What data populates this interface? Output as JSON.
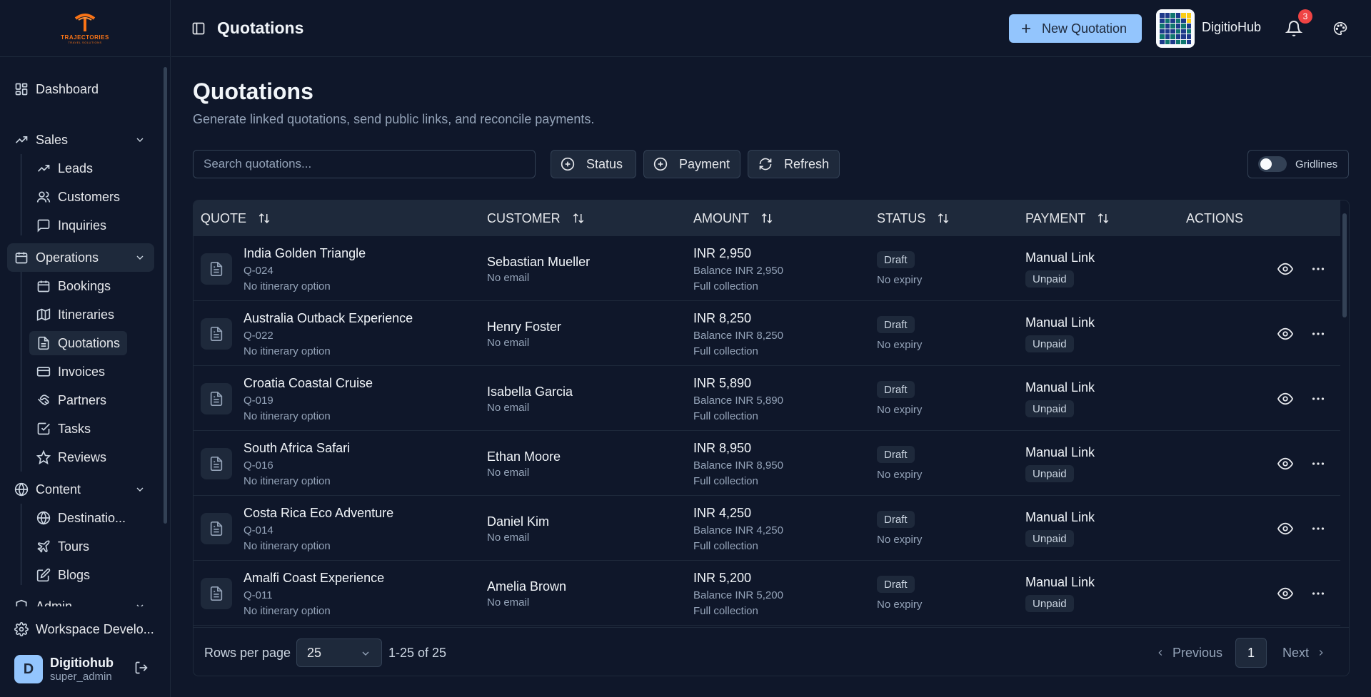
{
  "brand": {
    "logo_text": "TRAJECTORIES",
    "logo_sub": "TRAVEL SOLUTIONS"
  },
  "sidebar": {
    "dashboard": "Dashboard",
    "sales": {
      "label": "Sales",
      "items": [
        "Leads",
        "Customers",
        "Inquiries"
      ]
    },
    "operations": {
      "label": "Operations",
      "items": [
        "Bookings",
        "Itineraries",
        "Quotations",
        "Invoices",
        "Partners",
        "Tasks",
        "Reviews"
      ]
    },
    "content": {
      "label": "Content",
      "items": [
        "Destinatio...",
        "Tours",
        "Blogs"
      ]
    },
    "admin": "Admin",
    "workspace": "Workspace Develo...",
    "user": {
      "initial": "D",
      "name": "Digitiohub",
      "role": "super_admin"
    }
  },
  "header": {
    "title": "Quotations",
    "new_button": "New Quotation",
    "org_name": "DigitioHub",
    "notifications": "3"
  },
  "main": {
    "title": "Quotations",
    "subtitle": "Generate linked quotations, send public links, and reconcile payments.",
    "search_placeholder": "Search quotations...",
    "filters": {
      "status": "Status",
      "payment": "Payment",
      "refresh": "Refresh"
    },
    "gridlines": "Gridlines"
  },
  "table": {
    "columns": {
      "quote": "QUOTE",
      "customer": "CUSTOMER",
      "amount": "AMOUNT",
      "status": "STATUS",
      "payment": "PAYMENT",
      "actions": "ACTIONS"
    },
    "rows": [
      {
        "title": "India Golden Triangle",
        "code": "Q-024",
        "option": "No itinerary option",
        "customer": "Sebastian Mueller",
        "email": "No email",
        "amount": "INR 2,950",
        "balance": "Balance INR 2,950",
        "collection": "Full collection",
        "status": "Draft",
        "expiry": "No expiry",
        "method": "Manual Link",
        "payment": "Unpaid"
      },
      {
        "title": "Australia Outback Experience",
        "code": "Q-022",
        "option": "No itinerary option",
        "customer": "Henry Foster",
        "email": "No email",
        "amount": "INR 8,250",
        "balance": "Balance INR 8,250",
        "collection": "Full collection",
        "status": "Draft",
        "expiry": "No expiry",
        "method": "Manual Link",
        "payment": "Unpaid"
      },
      {
        "title": "Croatia Coastal Cruise",
        "code": "Q-019",
        "option": "No itinerary option",
        "customer": "Isabella Garcia",
        "email": "No email",
        "amount": "INR 5,890",
        "balance": "Balance INR 5,890",
        "collection": "Full collection",
        "status": "Draft",
        "expiry": "No expiry",
        "method": "Manual Link",
        "payment": "Unpaid"
      },
      {
        "title": "South Africa Safari",
        "code": "Q-016",
        "option": "No itinerary option",
        "customer": "Ethan Moore",
        "email": "No email",
        "amount": "INR 8,950",
        "balance": "Balance INR 8,950",
        "collection": "Full collection",
        "status": "Draft",
        "expiry": "No expiry",
        "method": "Manual Link",
        "payment": "Unpaid"
      },
      {
        "title": "Costa Rica Eco Adventure",
        "code": "Q-014",
        "option": "No itinerary option",
        "customer": "Daniel Kim",
        "email": "No email",
        "amount": "INR 4,250",
        "balance": "Balance INR 4,250",
        "collection": "Full collection",
        "status": "Draft",
        "expiry": "No expiry",
        "method": "Manual Link",
        "payment": "Unpaid"
      },
      {
        "title": "Amalfi Coast Experience",
        "code": "Q-011",
        "option": "No itinerary option",
        "customer": "Amelia Brown",
        "email": "No email",
        "amount": "INR 5,200",
        "balance": "Balance INR 5,200",
        "collection": "Full collection",
        "status": "Draft",
        "expiry": "No expiry",
        "method": "Manual Link",
        "payment": "Unpaid"
      }
    ]
  },
  "footer": {
    "rows_per_page_label": "Rows per page",
    "rows_per_page": "25",
    "range": "1-25 of 25",
    "previous": "Previous",
    "page": "1",
    "next": "Next"
  },
  "colors": {
    "accent": "#93c5fd",
    "badge": "#ef4444",
    "logo": "#f97316",
    "background": "#0f172a"
  }
}
